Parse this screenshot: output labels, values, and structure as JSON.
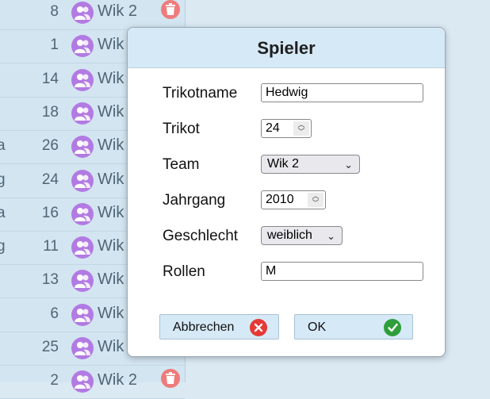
{
  "list": {
    "rows": [
      {
        "prefix": "",
        "number": "8",
        "team": "Wik 2",
        "trash": true
      },
      {
        "prefix": "",
        "number": "1",
        "team": "Wik",
        "trash": false
      },
      {
        "prefix": "",
        "number": "14",
        "team": "Wik",
        "trash": false
      },
      {
        "prefix": "",
        "number": "18",
        "team": "Wik",
        "trash": false
      },
      {
        "prefix": "a",
        "number": "26",
        "team": "Wik",
        "trash": false
      },
      {
        "prefix": "g",
        "number": "24",
        "team": "Wik",
        "trash": false
      },
      {
        "prefix": "a",
        "number": "16",
        "team": "Wik",
        "trash": false
      },
      {
        "prefix": "g",
        "number": "11",
        "team": "Wik",
        "trash": false
      },
      {
        "prefix": "",
        "number": "13",
        "team": "Wik",
        "trash": false
      },
      {
        "prefix": "",
        "number": "6",
        "team": "Wik",
        "trash": false
      },
      {
        "prefix": "",
        "number": "25",
        "team": "Wik",
        "trash": false
      },
      {
        "prefix": "",
        "number": "2",
        "team": "Wik 2",
        "trash": true
      }
    ]
  },
  "dialog": {
    "title": "Spieler",
    "fields": {
      "trikotname": {
        "label": "Trikotname",
        "value": "Hedwig"
      },
      "trikot": {
        "label": "Trikot",
        "value": "24"
      },
      "team": {
        "label": "Team",
        "value": "Wik 2"
      },
      "jahrgang": {
        "label": "Jahrgang",
        "value": "2010"
      },
      "geschlecht": {
        "label": "Geschlecht",
        "value": "weiblich"
      },
      "rollen": {
        "label": "Rollen",
        "value": "M"
      }
    },
    "buttons": {
      "cancel": {
        "label": "Abbrechen",
        "icon": "x-circle-icon",
        "color": "#e53935"
      },
      "ok": {
        "label": "OK",
        "icon": "check-circle-icon",
        "color": "#2e9e3a"
      }
    }
  },
  "colors": {
    "team_icon": "#b27ae3",
    "trash_icon": "#ef7b7b",
    "header": "#d6e9f6"
  }
}
